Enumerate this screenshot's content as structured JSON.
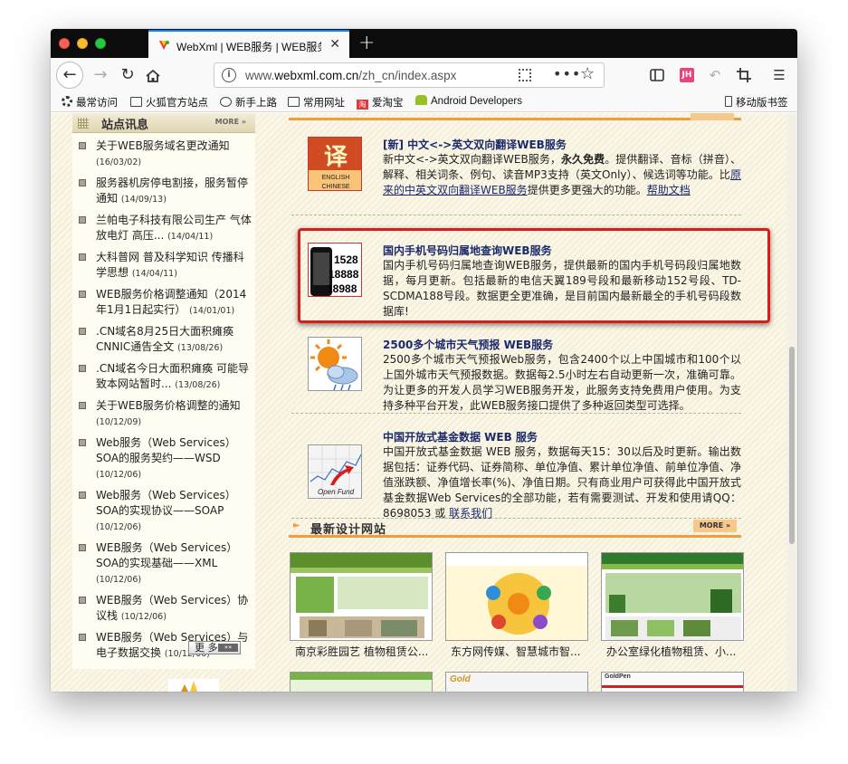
{
  "browser": {
    "tab_title": "WebXml | WEB服务 | WEB服务能",
    "url_prefix": "www.",
    "url_domain": "webxml.com.cn",
    "url_path": "/zh_cn/index.aspx",
    "more_dots": "•••",
    "profile_badge": "JH"
  },
  "bookmarks": [
    {
      "label": "最常访问",
      "icon": "gear-icon"
    },
    {
      "label": "火狐官方站点",
      "icon": "folder-icon"
    },
    {
      "label": "新手上路",
      "icon": "globe-icon"
    },
    {
      "label": "常用网址",
      "icon": "folder-icon"
    },
    {
      "label": "爱淘宝",
      "icon": "taobao-icon"
    },
    {
      "label": "Android Developers",
      "icon": "android-icon"
    },
    {
      "label": "移动版书签",
      "icon": "phone-icon"
    }
  ],
  "left": {
    "title": "站点讯息",
    "more": "MORE »",
    "more_button": "更 多",
    "items": [
      {
        "text": "关于WEB服务域名更改通知",
        "date": "(16/03/02)"
      },
      {
        "text": "服务器机房停电割接，服务暂停通知",
        "date": "(14/09/13)"
      },
      {
        "text": "兰帕电子科技有限公司生产 气体放电灯 高压...",
        "date": "(14/04/11)"
      },
      {
        "text": "大科普网 普及科学知识 传播科学思想",
        "date": "(14/04/11)"
      },
      {
        "text": "WEB服务价格调整通知（2014年1月1日起实行）",
        "date": "(14/01/01)"
      },
      {
        "text": ".CN域名8月25日大面积瘫痪 CNNIC通告全文",
        "date": "(13/08/26)"
      },
      {
        "text": ".CN域名今日大面积瘫痪 可能导致本网站暂时...",
        "date": "(13/08/26)"
      },
      {
        "text": "关于WEB服务价格调整的通知",
        "date": "(10/12/09)"
      },
      {
        "text": "Web服务（Web Services）SOA的服务契约——WSD",
        "date": "(10/12/06)"
      },
      {
        "text": "Web服务（Web Services）SOA的实现协议——SOAP",
        "date": "(10/12/06)"
      },
      {
        "text": "WEB服务（Web Services）SOA的实现基础——XML",
        "date": "(10/12/06)"
      },
      {
        "text": "WEB服务（Web Services）协议栈",
        "date": "(10/12/06)"
      },
      {
        "text": "WEB服务（Web Services）与电子数据交换",
        "date": "(10/12/06)"
      }
    ]
  },
  "services": [
    {
      "title": "[新] 中文<->英文双向翻译WEB服务",
      "body_pre": "新中文<->英文双向翻译WEB服务，",
      "body_bold": "永久免费",
      "body_mid": "。提供翻译、音标（拼音）、解释、相关词条、例句、读音MP3支持（英文Only）、候选词等功能。比",
      "link1": "原来的中英文双向翻译WEB服务",
      "body_post": "提供更多更强大的功能。",
      "link2": "帮助文档",
      "image_label_top": "译",
      "image_label_en": "ENGLISH",
      "image_label_cn": "CHINESE"
    },
    {
      "title": "国内手机号码归属地查询WEB服务",
      "body": "国内手机号码归属地查询WEB服务，提供最新的国内手机号码段归属地数据，每月更新。包括最新的电信天翼189号段和最新移动152号段、TD-SCDMA188号段。数据更全更准确，是目前国内最新最全的手机号码段数据库!",
      "image_numbers": [
        "1528",
        "18888",
        "18988"
      ]
    },
    {
      "title": "2500多个城市天气预报 WEB服务",
      "body": "2500多个城市天气预报Web服务，包含2400个以上中国城市和100个以上国外城市天气预报数据。数据每2.5小时左右自动更新一次，准确可靠。为让更多的开发人员学习WEB服务开发，此服务支持免费用户使用。为支持多种平台开发，此WEB服务接口提供了多种返回类型可选择。"
    },
    {
      "title": "中国开放式基金数据 WEB 服务",
      "body": "中国开放式基金数据 WEB 服务，数据每天15：30以后及时更新。输出数据包括：证券代码、证券简称、单位净值、累计单位净值、前单位净值、净值涨跌额、净值增长率(%)、净值日期。只有商业用户可获得此中国开放式基金数据Web Services的全部功能，若有需要测试、开发和使用请QQ：8698053 或 ",
      "link": "联系我们",
      "image_label": "Open Fund"
    }
  ],
  "sites": {
    "title": "最新设计网站",
    "more": "MORE »",
    "items": [
      {
        "caption": "南京彩胜园艺 植物租赁公..."
      },
      {
        "caption": "东方网传媒、智慧城市智..."
      },
      {
        "caption": "办公室绿化植物租赁、小..."
      }
    ],
    "row2_labels": [
      "",
      "Gold",
      "GoldPen"
    ]
  },
  "colors": {
    "accent_orange": "#f39c3c",
    "highlight_red": "#d91d1d",
    "title_blue": "#1a2a6c",
    "page_bg": "#fbf7e8"
  }
}
